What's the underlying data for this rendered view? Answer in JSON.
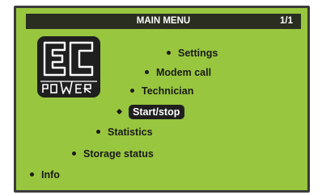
{
  "header": {
    "title": "MAIN MENU",
    "page_indicator": "1/1"
  },
  "logo": {
    "letters": "EC",
    "word": "POWER",
    "icon": "ec-power-logo"
  },
  "menu": {
    "items": [
      {
        "label": "Settings",
        "selected": false
      },
      {
        "label": "Modem call",
        "selected": false
      },
      {
        "label": "Technician",
        "selected": false
      },
      {
        "label": "Start/stop",
        "selected": true
      },
      {
        "label": "Statistics",
        "selected": false
      },
      {
        "label": "Storage status",
        "selected": false
      },
      {
        "label": "Info",
        "selected": false
      }
    ]
  },
  "colors": {
    "lcd_background": "#98c63e",
    "title_bar": "#2a2e20",
    "text": "#1a1a1a",
    "highlight": "#1f1f1f"
  }
}
